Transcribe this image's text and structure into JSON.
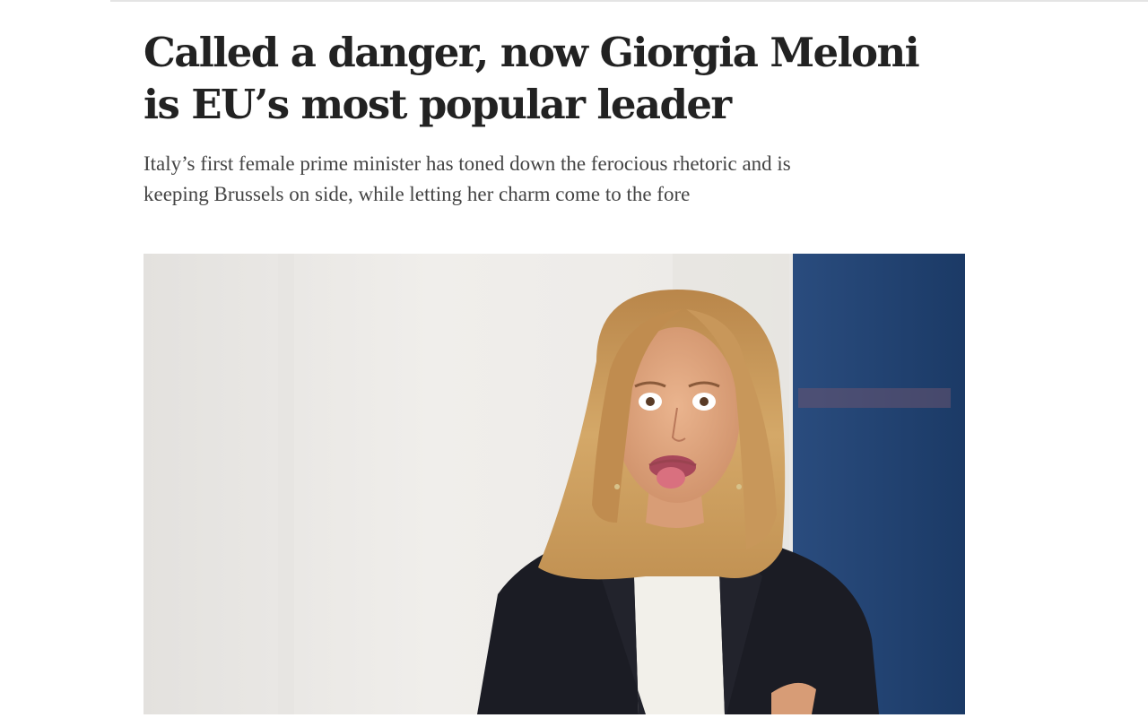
{
  "article": {
    "headline_line1": "Called a danger, now Giorgia Meloni",
    "headline_line2": "is EU’s most popular leader",
    "standfirst_line1": "Italy’s first female prime minister has toned down the ferocious rhetoric and is",
    "standfirst_line2": "keeping Brussels on side, while letting her charm come to the fore"
  },
  "hero_image": {
    "colors": {
      "wall": "#ebe9e6",
      "flag_blue": "#1f3f6e",
      "hair": "#c99a5b",
      "jacket": "#1a1b22",
      "top": "#f1efe9",
      "skin": "#e0a57e"
    }
  }
}
